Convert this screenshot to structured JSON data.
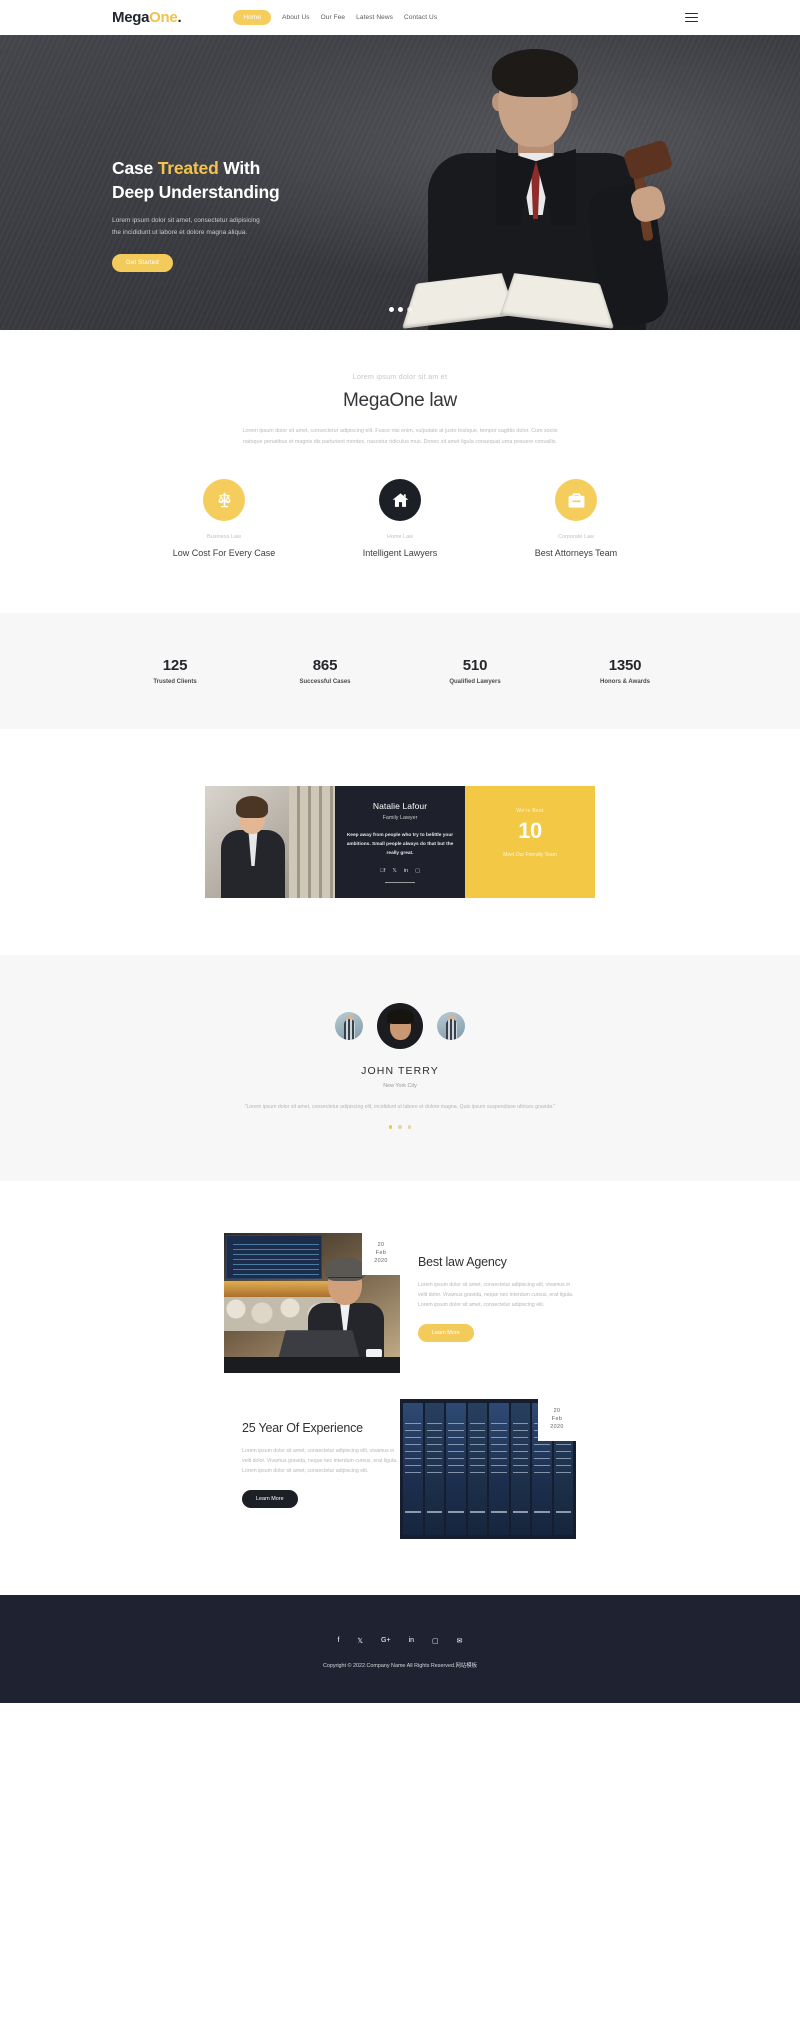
{
  "header": {
    "logo": {
      "part1": "Mega",
      "part2": "One",
      "dot": "."
    },
    "nav": [
      {
        "label": "Home",
        "active": true
      },
      {
        "label": "About Us",
        "active": false
      },
      {
        "label": "Our Fee",
        "active": false
      },
      {
        "label": "Latest News",
        "active": false
      },
      {
        "label": "Contact Us",
        "active": false
      }
    ],
    "menu_icon": "hamburger-icon"
  },
  "hero": {
    "title_part1": "Case ",
    "title_highlight": "Treated",
    "title_part2": " With",
    "title_line2": "Deep Understanding",
    "description_line1": "Lorem ipsum dolor sit amet, consectetur adipisicing",
    "description_line2": "the incididunt ut labore et dolore magna aliqua.",
    "cta_label": "Get Started",
    "slider_dots": 3,
    "active_dot": 1
  },
  "intro": {
    "kicker": "Lorem ipsum dolor sit am et",
    "title": "MegaOne law",
    "description": "Lorem ipsum dolor sit amet, consectetur adipiscing elit. Fusce nisi enim, vulputate at justo tristique, tempor sagittis dolor. Cum sociis natoque penatibus et magnis dis parturient montes, nascetur ridiculus mus. Donec sit amet ligula consequat urna posuere convallis."
  },
  "services": [
    {
      "icon": "scales-icon",
      "category": "Business Law",
      "title": "Low Cost For Every Case",
      "dark": false
    },
    {
      "icon": "home-icon",
      "category": "Home Law",
      "title": "Intelligent Lawyers",
      "dark": true
    },
    {
      "icon": "briefcase-icon",
      "category": "Corporate Law",
      "title": "Best Attorneys Team",
      "dark": false
    }
  ],
  "stats": [
    {
      "number": "125",
      "label": "Trusted Clients"
    },
    {
      "number": "865",
      "label": "Successful Cases"
    },
    {
      "number": "510",
      "label": "Qualified Lawyers"
    },
    {
      "number": "1350",
      "label": "Honors & Awards"
    }
  ],
  "team": {
    "name": "Natalie Lafour",
    "role": "Family Lawyer",
    "quote": "Keep away from people who try to belittle your ambitions. Small people always do that but the really great.",
    "socials": [
      "facebook-icon",
      "twitter-icon",
      "linkedin-icon",
      "instagram-icon"
    ],
    "promo_kicker": "We're Best",
    "promo_number": "10",
    "promo_label": "Meet Our Friendly Team"
  },
  "testimonial": {
    "name": "JOHN TERRY",
    "city": "New York City",
    "quote": "\"Lorem ipsum dolor sit amet, consectetur adipiscing elit, incididunt ut labore et dolore magna. Quis ipsum suspendisse ultrices gravida.\"",
    "dots": 3,
    "active_dot": 1
  },
  "blog": [
    {
      "date_day": "20",
      "date_month": "Feb",
      "date_year": "2020",
      "title": "Best law Agency",
      "description": "Lorem ipsum dolor sit amet, consectetur adipiscing elit, vivamus in velit dolor. Vivamus gravida, neque nec interdum cursus, erat ligula. Lorem ipsum dolor sit amet, consectetur adipiscing elit.",
      "cta_label": "Learn More"
    },
    {
      "date_day": "20",
      "date_month": "Feb",
      "date_year": "2020",
      "title": "25 Year Of Experience",
      "description": "Lorem ipsum dolor sit amet, consectetur adipiscing elit, vivamus in velit dolor. Vivamus gravida, neque nec interdum cursus, erat ligula. Lorem ipsum dolor sit amet, consectetur adipiscing elit.",
      "cta_label": "Learn More"
    }
  ],
  "footer": {
    "socials": [
      "facebook-icon",
      "twitter-icon",
      "google-plus-icon",
      "linkedin-icon",
      "instagram-icon",
      "email-icon"
    ],
    "copyright": "Copyright © 2022.Company Name All Rights Reserved.网站模板"
  },
  "colors": {
    "accent": "#f3cb5b",
    "dark": "#1f2230",
    "text": "#35363a",
    "muted": "#b9b9bd"
  }
}
